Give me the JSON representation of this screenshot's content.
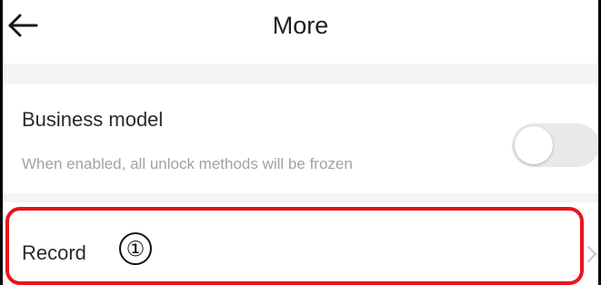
{
  "header": {
    "title": "More",
    "back_icon": "arrow-left-icon"
  },
  "business_model": {
    "title": "Business model",
    "description": "When enabled, all unlock methods will be frozen",
    "toggle_state": "off"
  },
  "record": {
    "label": "Record",
    "chevron_icon": "chevron-right-icon"
  },
  "annotation": {
    "marker": "①",
    "highlight_color": "#e8141a"
  }
}
